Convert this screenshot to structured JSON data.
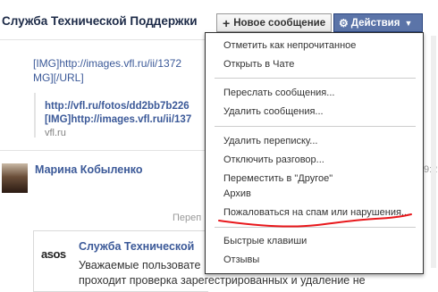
{
  "header": {
    "title": "Служба Технической Поддержки",
    "new_message_label": "Новое сообщение",
    "actions_label": "Действия"
  },
  "background_message": {
    "lines": [
      "[IMG]http://images.vfl.ru/ii/1372",
      "MG][/URL]"
    ],
    "preview": {
      "link_line1": "http://vfl.ru/fotos/dd2bb7b226",
      "link_line2": "[IMG]http://images.vfl.ru/ii/137",
      "domain": "vfl.ru"
    }
  },
  "second_message": {
    "author": "Марина Кобыленко",
    "time_partial": "9:2",
    "forwarded_label": "Переп",
    "forwarded": {
      "logo_text": "asos",
      "author": "Служба Технической",
      "text_line1": "Уважаемые пользовате",
      "text_line2": "проходит проверка зарегестрированных и удаление не"
    }
  },
  "actions_menu": {
    "group1": [
      "Отметить как непрочитанное",
      "Открыть в Чате"
    ],
    "group2": [
      "Переслать сообщения...",
      "Удалить сообщения..."
    ],
    "group3": [
      "Удалить переписку...",
      "Отключить разговор...",
      "Переместить в \"Другое\"",
      "Архив",
      "Пожаловаться на спам или нарушения..."
    ],
    "group4": [
      "Быстрые клавиши",
      "Отзывы"
    ]
  },
  "colors": {
    "facebook_blue": "#3b5998",
    "actions_button": "#5b74a8",
    "annotation_red": "#e8171b"
  }
}
